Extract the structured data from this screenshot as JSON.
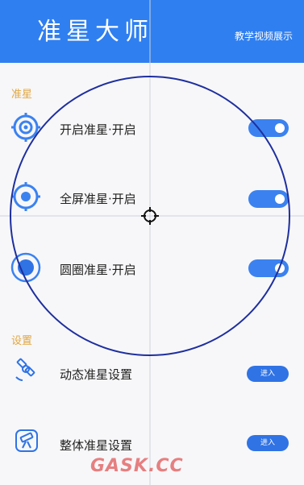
{
  "header": {
    "title": "准星大师",
    "demo_link": "教学视频展示"
  },
  "sections": {
    "crosshair": "准星",
    "settings": "设置"
  },
  "rows": [
    {
      "label": "开启准星·开启",
      "icon": "crosshair-ring-icon",
      "state": "on"
    },
    {
      "label": "全屏准星·开启",
      "icon": "crosshair-dot-icon",
      "state": "on"
    },
    {
      "label": "圆圈准星·开启",
      "icon": "circle-dot-icon",
      "state": "on"
    }
  ],
  "settings_rows": [
    {
      "label": "动态准星设置",
      "icon": "satellite-icon",
      "button": "进入"
    },
    {
      "label": "整体准星设置",
      "icon": "telescope-icon",
      "button": "进入"
    }
  ],
  "overlay": {
    "center_marker": "target-reticle-icon"
  },
  "watermark": "GASK.CC",
  "colors": {
    "header": "#2f7ff0",
    "accent": "#3b82f0",
    "section_label": "#e2a640",
    "overlay_circle": "#1e2f9e"
  }
}
